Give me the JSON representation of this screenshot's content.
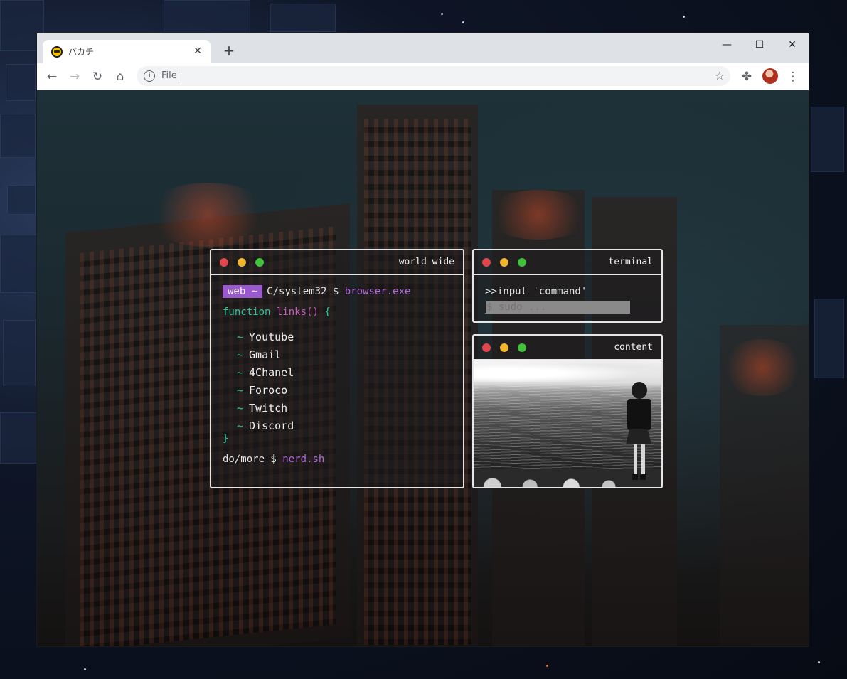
{
  "browser": {
    "tab": {
      "title": "バカチ",
      "close_glyph": "✕"
    },
    "new_tab_glyph": "+",
    "window_controls": {
      "minimize": "—",
      "maximize": "☐",
      "close": "✕"
    },
    "toolbar": {
      "back_glyph": "←",
      "forward_glyph": "→",
      "reload_glyph": "↻",
      "home_glyph": "⌂",
      "address_scheme_label": "File",
      "address_value": "",
      "star_glyph": "☆",
      "extensions_glyph": "✤",
      "menu_glyph": "⋮"
    }
  },
  "world_wide": {
    "title": "world wide",
    "prompt_tag": "web ~",
    "prompt_path": "C/system32 $",
    "prompt_command": "browser.exe",
    "function_keyword": "function",
    "function_name": "links()",
    "function_open": "{",
    "link_marker": "~",
    "links": [
      "Youtube",
      "Gmail",
      "4Chanel",
      "Foroco",
      "Twitch",
      "Discord"
    ],
    "function_close": "}",
    "more_path": "do/more $",
    "more_command": "nerd.sh"
  },
  "terminal": {
    "title": "terminal",
    "heading": ">>input 'command'",
    "input_placeholder": "$ sudo ..."
  },
  "content": {
    "title": "content"
  },
  "colors": {
    "accent_purple": "#9b59d0",
    "accent_teal": "#24c89a",
    "traffic_red": "#e0474c",
    "traffic_yellow": "#f2b52e",
    "traffic_green": "#42c13a",
    "panel_border": "#e6e6e6"
  },
  "icons": {
    "favicon": "yellow-face-icon",
    "page_info": "info-icon",
    "bookmark": "star-icon",
    "extensions": "puzzle-icon",
    "profile": "avatar"
  }
}
